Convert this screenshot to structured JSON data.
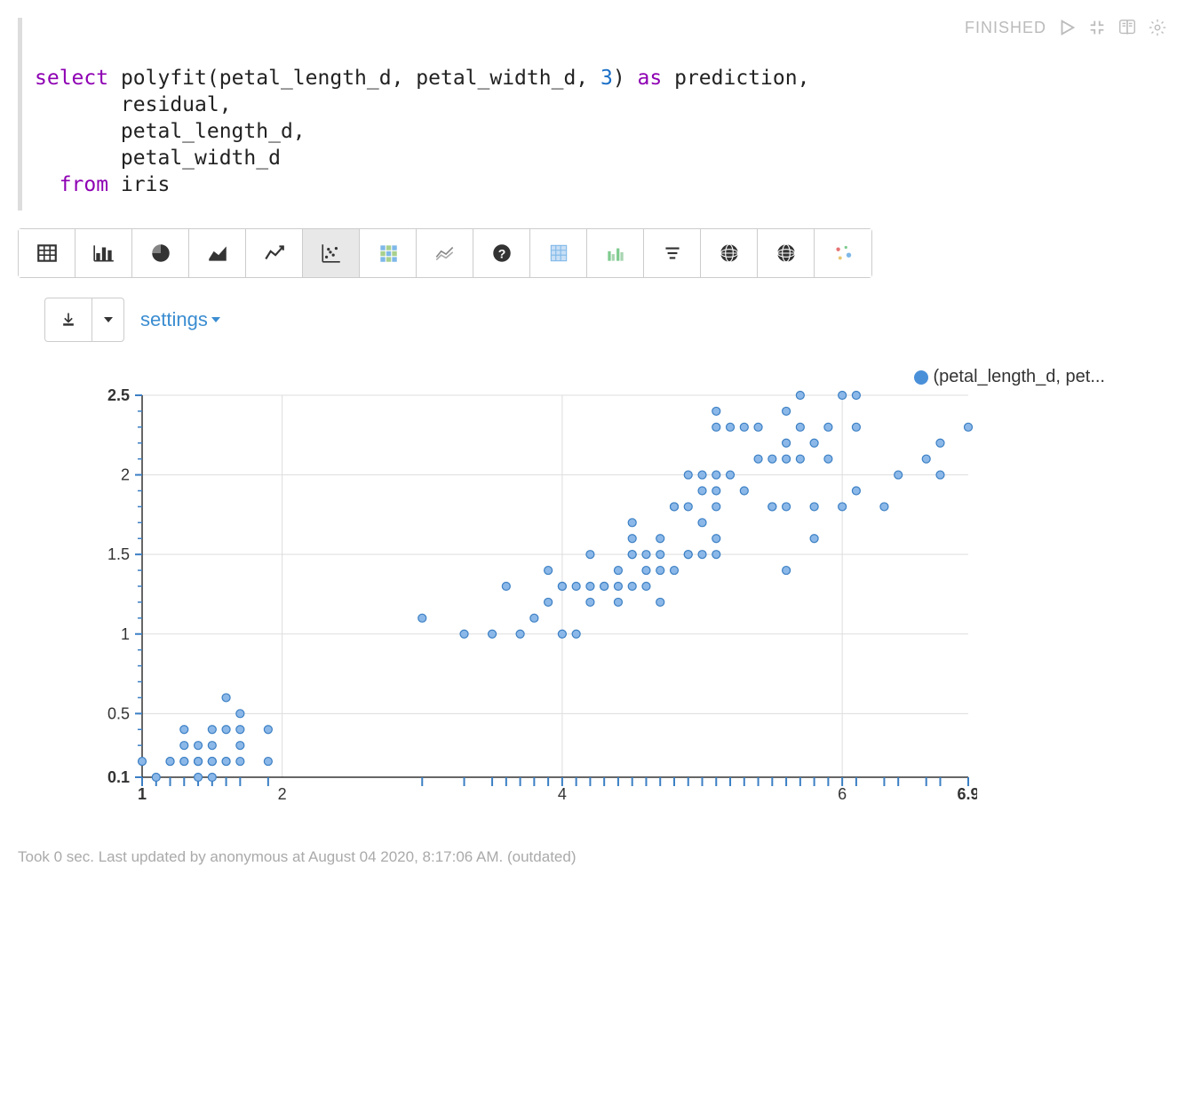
{
  "cell": {
    "status": "FINISHED",
    "code": {
      "kw_select": "select",
      "fn": " polyfit(petal_length_d, petal_width_d, ",
      "num": "3",
      "after_num": ") ",
      "kw_as": "as",
      "after_as": " prediction,",
      "l2": "       residual,",
      "l3": "       petal_length_d,",
      "l4": "       petal_width_d",
      "kw_from": "  from",
      "from_tbl": " iris"
    }
  },
  "settings_label": "settings",
  "legend_label": "(petal_length_d, pet...",
  "footer_text": "Took 0 sec. Last updated by anonymous at August 04 2020, 8:17:06 AM. (outdated)",
  "chart_data": {
    "type": "scatter",
    "legend": "(petal_length_d, pet...",
    "xlabel": "",
    "ylabel": "",
    "xlim": [
      1,
      6.9
    ],
    "ylim": [
      0.1,
      2.5
    ],
    "xticks": [
      1,
      2,
      4,
      6,
      6.9
    ],
    "yticks": [
      0.1,
      0.5,
      1,
      1.5,
      2,
      2.5
    ],
    "series": [
      {
        "name": "(petal_length_d, petal_width_d)",
        "points": [
          [
            1.0,
            0.2
          ],
          [
            1.1,
            0.1
          ],
          [
            1.2,
            0.2
          ],
          [
            1.2,
            0.2
          ],
          [
            1.3,
            0.2
          ],
          [
            1.3,
            0.2
          ],
          [
            1.3,
            0.3
          ],
          [
            1.3,
            0.4
          ],
          [
            1.4,
            0.1
          ],
          [
            1.4,
            0.2
          ],
          [
            1.4,
            0.2
          ],
          [
            1.4,
            0.2
          ],
          [
            1.4,
            0.3
          ],
          [
            1.5,
            0.1
          ],
          [
            1.5,
            0.2
          ],
          [
            1.5,
            0.2
          ],
          [
            1.5,
            0.2
          ],
          [
            1.5,
            0.3
          ],
          [
            1.5,
            0.4
          ],
          [
            1.6,
            0.2
          ],
          [
            1.6,
            0.2
          ],
          [
            1.6,
            0.4
          ],
          [
            1.6,
            0.6
          ],
          [
            1.7,
            0.2
          ],
          [
            1.7,
            0.3
          ],
          [
            1.7,
            0.4
          ],
          [
            1.7,
            0.5
          ],
          [
            1.9,
            0.2
          ],
          [
            1.9,
            0.4
          ],
          [
            3.0,
            1.1
          ],
          [
            3.3,
            1.0
          ],
          [
            3.5,
            1.0
          ],
          [
            3.6,
            1.3
          ],
          [
            3.7,
            1.0
          ],
          [
            3.8,
            1.1
          ],
          [
            3.9,
            1.2
          ],
          [
            3.9,
            1.4
          ],
          [
            4.0,
            1.0
          ],
          [
            4.0,
            1.3
          ],
          [
            4.0,
            1.3
          ],
          [
            4.1,
            1.0
          ],
          [
            4.1,
            1.3
          ],
          [
            4.2,
            1.2
          ],
          [
            4.2,
            1.3
          ],
          [
            4.2,
            1.5
          ],
          [
            4.3,
            1.3
          ],
          [
            4.3,
            1.3
          ],
          [
            4.4,
            1.2
          ],
          [
            4.4,
            1.3
          ],
          [
            4.4,
            1.4
          ],
          [
            4.5,
            1.3
          ],
          [
            4.5,
            1.5
          ],
          [
            4.5,
            1.5
          ],
          [
            4.5,
            1.6
          ],
          [
            4.5,
            1.7
          ],
          [
            4.6,
            1.3
          ],
          [
            4.6,
            1.4
          ],
          [
            4.6,
            1.5
          ],
          [
            4.7,
            1.2
          ],
          [
            4.7,
            1.4
          ],
          [
            4.7,
            1.5
          ],
          [
            4.7,
            1.6
          ],
          [
            4.8,
            1.4
          ],
          [
            4.8,
            1.8
          ],
          [
            4.8,
            1.8
          ],
          [
            4.9,
            1.5
          ],
          [
            4.9,
            1.5
          ],
          [
            4.9,
            1.8
          ],
          [
            4.9,
            2.0
          ],
          [
            5.0,
            1.5
          ],
          [
            5.0,
            1.7
          ],
          [
            5.0,
            1.9
          ],
          [
            5.0,
            2.0
          ],
          [
            5.1,
            1.5
          ],
          [
            5.1,
            1.6
          ],
          [
            5.1,
            1.8
          ],
          [
            5.1,
            1.9
          ],
          [
            5.1,
            2.0
          ],
          [
            5.1,
            2.3
          ],
          [
            5.1,
            2.4
          ],
          [
            5.2,
            2.0
          ],
          [
            5.2,
            2.3
          ],
          [
            5.3,
            1.9
          ],
          [
            5.3,
            2.3
          ],
          [
            5.4,
            2.1
          ],
          [
            5.4,
            2.3
          ],
          [
            5.5,
            1.8
          ],
          [
            5.5,
            1.8
          ],
          [
            5.5,
            2.1
          ],
          [
            5.6,
            1.4
          ],
          [
            5.6,
            1.8
          ],
          [
            5.6,
            2.1
          ],
          [
            5.6,
            2.2
          ],
          [
            5.6,
            2.4
          ],
          [
            5.7,
            2.1
          ],
          [
            5.7,
            2.3
          ],
          [
            5.7,
            2.5
          ],
          [
            5.8,
            1.6
          ],
          [
            5.8,
            1.8
          ],
          [
            5.8,
            2.2
          ],
          [
            5.9,
            2.1
          ],
          [
            5.9,
            2.3
          ],
          [
            6.0,
            1.8
          ],
          [
            6.0,
            2.5
          ],
          [
            6.1,
            1.9
          ],
          [
            6.1,
            2.3
          ],
          [
            6.1,
            2.5
          ],
          [
            6.3,
            1.8
          ],
          [
            6.4,
            2.0
          ],
          [
            6.6,
            2.1
          ],
          [
            6.7,
            2.0
          ],
          [
            6.7,
            2.2
          ],
          [
            6.9,
            2.3
          ]
        ]
      }
    ]
  }
}
